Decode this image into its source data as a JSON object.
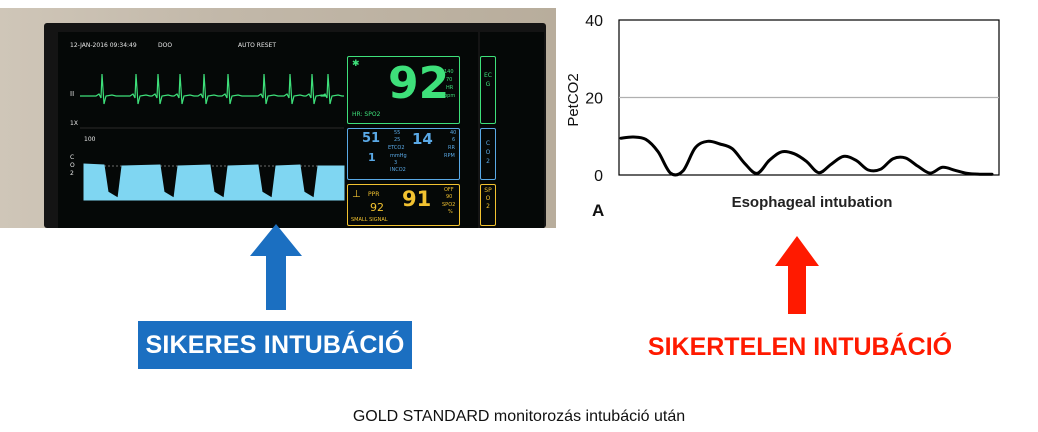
{
  "monitor": {
    "datetime": "12-JAN-2016 09:34:49",
    "mode": "DOO",
    "auto_reset": "AUTO RESET",
    "lead": "II",
    "gain": "1X",
    "co2_scale": "100",
    "co2_label": "CO2",
    "hr_value": "92",
    "hr_source": "HR: SPO2",
    "hr_upper": "140",
    "hr_lower": "70",
    "hr_unit_hr": "HR",
    "hr_unit_bpm": "bpm",
    "ecg_tab": "ECG",
    "etco2_value": "51",
    "etco2_hi": "55",
    "etco2_lo": "25",
    "etco2_label": "ETCO2",
    "mmhg_label": "mmHg",
    "inco2_value": "1",
    "inco2_num": "3",
    "inco2_label": "INCO2",
    "rr_value": "14",
    "rr_hi": "40",
    "rr_lo": "6",
    "rr_label": "RR",
    "rpm_label": "RPM",
    "co2_tab": "CO2",
    "ppr_label": "PPR",
    "ppr_value": "92",
    "spo2_value": "91",
    "spo2_off": "OFF",
    "spo2_lim": "90",
    "spo2_label": "SPO2",
    "spo2_pct": "%",
    "spo2_tab": "SPO2",
    "small_signal": "SMALL SIGNAL",
    "colors": {
      "ecg": "#3ee07a",
      "co2": "#5aa9e6",
      "spo2": "#f2c230",
      "wave_fill": "#7fd6f2"
    }
  },
  "chart_data": {
    "type": "line",
    "title": "Esophageal intubation",
    "panel_label": "A",
    "ylabel": "PetCO2",
    "ylim": [
      0,
      40
    ],
    "y_ticks": [
      "0",
      "20",
      "40"
    ],
    "gridlines": [
      20
    ],
    "series": [
      {
        "x": [
          0,
          1,
          2,
          3,
          4,
          5,
          6,
          7,
          8,
          9,
          10,
          11,
          12,
          13,
          14,
          15,
          16,
          17,
          18,
          19,
          20,
          21,
          22,
          23,
          24,
          25,
          26,
          27,
          28,
          29,
          30
        ],
        "values": [
          9.5,
          9.8,
          9.2,
          6,
          0.5,
          1,
          7,
          8.7,
          8,
          6.8,
          3,
          0.4,
          3.8,
          6,
          5.5,
          3.5,
          0.6,
          2.8,
          4.8,
          3.8,
          1.3,
          1.5,
          4.2,
          4.4,
          2.3,
          0.5,
          2,
          1.2,
          0.4,
          0.2,
          0.2
        ]
      }
    ],
    "colors": {
      "line": "#000000",
      "grid": "#b0b0b0"
    }
  },
  "labels": {
    "success": "SIKERES INTUBÁCIÓ",
    "failure": "SIKERTELEN INTUBÁCIÓ",
    "success_color": "#1b6fc1",
    "failure_color": "#ff1a00"
  },
  "caption": "GOLD STANDARD monitorozás intubáció után"
}
